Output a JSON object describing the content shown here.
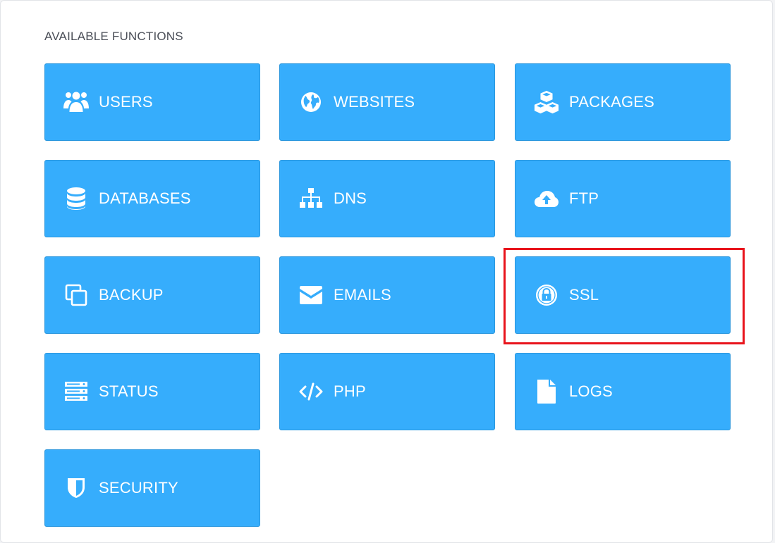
{
  "section": {
    "title": "AVAILABLE FUNCTIONS"
  },
  "colors": {
    "tile_background": "#36adfc",
    "highlight_border": "#e8141c"
  },
  "functions": [
    {
      "label": "USERS",
      "icon": "users-icon"
    },
    {
      "label": "WEBSITES",
      "icon": "globe-icon"
    },
    {
      "label": "PACKAGES",
      "icon": "cubes-icon"
    },
    {
      "label": "DATABASES",
      "icon": "database-icon"
    },
    {
      "label": "DNS",
      "icon": "sitemap-icon"
    },
    {
      "label": "FTP",
      "icon": "cloud-upload-icon"
    },
    {
      "label": "BACKUP",
      "icon": "copy-icon"
    },
    {
      "label": "EMAILS",
      "icon": "envelope-icon"
    },
    {
      "label": "SSL",
      "icon": "lock-icon",
      "highlighted": true
    },
    {
      "label": "STATUS",
      "icon": "server-icon"
    },
    {
      "label": "PHP",
      "icon": "code-icon"
    },
    {
      "label": "LOGS",
      "icon": "file-icon"
    },
    {
      "label": "SECURITY",
      "icon": "shield-icon"
    }
  ]
}
